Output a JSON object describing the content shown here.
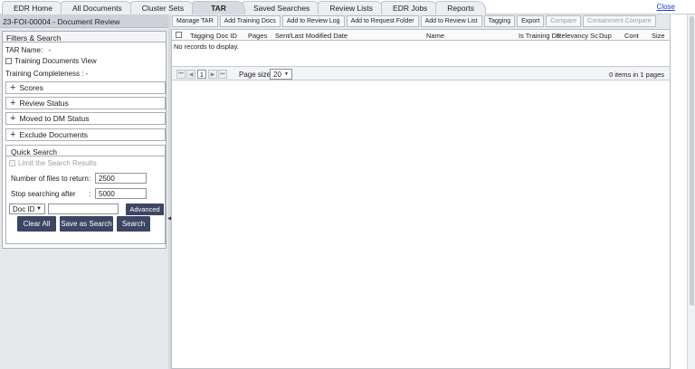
{
  "tabs": [
    "EDR Home",
    "All Documents",
    "Cluster Sets",
    "TAR",
    "Saved Searches",
    "Review Lists",
    "EDR Jobs",
    "Reports"
  ],
  "close_label": "Close",
  "left": {
    "doc_title": "23-FOI-00004 - Document Review",
    "filters_title": "Filters & Search",
    "tar_name_label": "TAR Name:",
    "tar_name_value": "-",
    "training_docs_view": "Training Documents View",
    "training_completeness": "Training Completeness : -",
    "sections": [
      "Scores",
      "Review Status",
      "Moved to DM Status",
      "Exclude Documents"
    ],
    "quick_search": {
      "title": "Quick Search",
      "limit_label": "Limit the Search Results",
      "num_files_label": "Number of files to return",
      "num_files_value": "2500",
      "stop_label": "Stop searching after",
      "stop_value": "5000",
      "colon": ":",
      "field_select": "Doc ID",
      "advanced": "Advanced"
    },
    "buttons": {
      "clear_all": "Clear All",
      "save_as_search": "Save as Search",
      "search": "Search"
    }
  },
  "toolbar": [
    "Manage TAR",
    "Add Training Docs",
    "Add to Review Log",
    "Add to Request Folder",
    "Add to Review List",
    "Tagging",
    "Export",
    "Compare",
    "Containment Compare"
  ],
  "grid": {
    "columns": [
      "Tagging",
      "Doc ID",
      "Pages",
      "Sent/Last Modified Date",
      "Name",
      "Is Training Dc",
      "Relevancy Sc",
      "Dup",
      "Cont",
      "Size"
    ],
    "empty": "No records to display.",
    "pager": {
      "page": "1",
      "page_size_label": "Page size:",
      "page_size": "20",
      "summary": "0 items in 1 pages"
    }
  }
}
